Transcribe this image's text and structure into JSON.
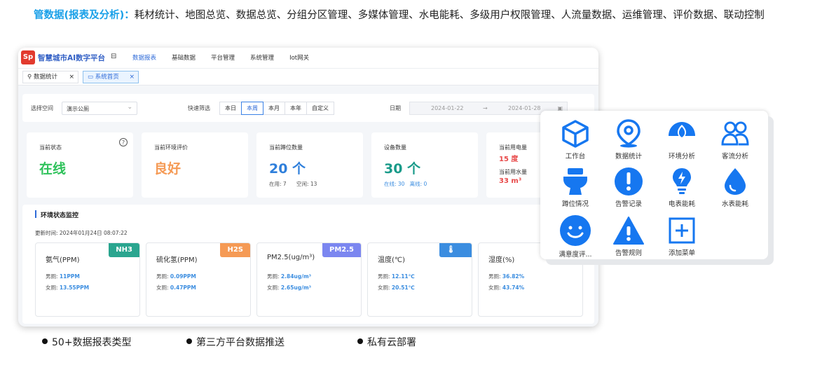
{
  "intro": {
    "heading": "管数据(报表及分析)：",
    "features": "耗材统计、地图总览、数据总览、分组分区管理、多媒体管理、水电能耗、多级用户权限管理、人流量数据、运维管理、评价数据、联动控制"
  },
  "app": {
    "logo_text": "Sp",
    "title": "智慧城市AI数字平台",
    "nav": [
      "数据报表",
      "基础数据",
      "平台管理",
      "系统管理",
      "Iot网关"
    ],
    "active_nav": "数据报表"
  },
  "tabs": [
    {
      "label": "数据统计",
      "close": "×"
    },
    {
      "label": "系统首页",
      "close": "×"
    }
  ],
  "filters": {
    "space_label": "选择空间",
    "space_value": "演示公厕",
    "quick_label": "快速筛选",
    "quick_options": [
      "本日",
      "本周",
      "本月",
      "本年",
      "自定义"
    ],
    "quick_selected": "本周",
    "date_label": "日期",
    "date_start": "2024-01-22",
    "date_sep": "→",
    "date_end": "2024-01-28"
  },
  "cards": {
    "status": {
      "title": "当前状态",
      "value": "在线",
      "color": "#2fc25b"
    },
    "env_eval": {
      "title": "当前环境评价",
      "value": "良好",
      "color": "#f59a55"
    },
    "pits": {
      "title": "当前蹲位数量",
      "value": "20 个",
      "sub": "在用: 7      空闲: 13",
      "color": "#2f7fdb"
    },
    "devices": {
      "title": "设备数量",
      "value": "30 个",
      "sub_online": "在线: 30",
      "sub_offline": "离线: 0",
      "color": "#1a9b8a"
    },
    "power": {
      "title": "当前用电量",
      "value": "15 度",
      "water_title": "当前用水量",
      "water_value": "33 m³",
      "color": "#e84a4a"
    }
  },
  "env": {
    "title": "环境状态监控",
    "updated": "更新时间: 2024年01月24日 08:07:22",
    "sensors": [
      {
        "name": "氨气(PPM)",
        "tag": "NH3",
        "tag_color": "#2aa58f",
        "male_label": "男厕:",
        "male": "11PPM",
        "female_label": "女厕:",
        "female": "13.55PPM"
      },
      {
        "name": "硫化氢(PPM)",
        "tag": "H2S",
        "tag_color": "#f59a55",
        "male_label": "男厕:",
        "male": "0.09PPM",
        "female_label": "女厕:",
        "female": "0.47PPM"
      },
      {
        "name": "PM2.5(ug/m³)",
        "tag": "PM2.5",
        "tag_color": "#7b86f0",
        "male_label": "男厕:",
        "male": "2.84ug/m³",
        "female_label": "女厕:",
        "female": "2.65ug/m³"
      },
      {
        "name": "温度(℃)",
        "tag": "🌡",
        "tag_color": "#3b8de0",
        "male_label": "男厕:",
        "male": "12.11℃",
        "female_label": "女厕:",
        "female": "20.51℃"
      },
      {
        "name": "湿度(%)",
        "tag": "",
        "tag_color": "#ffffff",
        "male_label": "男厕:",
        "male": "36.82%",
        "female_label": "女厕:",
        "female": "43.74%"
      }
    ]
  },
  "popup": {
    "accent": "#1677f0",
    "items": [
      {
        "label": "工作台",
        "icon": "cube-icon"
      },
      {
        "label": "数据统计",
        "icon": "map-pin-icon"
      },
      {
        "label": "环境分析",
        "icon": "lotus-icon"
      },
      {
        "label": "客流分析",
        "icon": "users-icon"
      },
      {
        "label": "蹲位情况",
        "icon": "toilet-icon"
      },
      {
        "label": "告警记录",
        "icon": "alert-circle-icon"
      },
      {
        "label": "电表能耗",
        "icon": "bulb-icon"
      },
      {
        "label": "水表能耗",
        "icon": "water-drop-icon"
      },
      {
        "label": "满意度评...",
        "icon": "smile-icon"
      },
      {
        "label": "告警规则",
        "icon": "warning-triangle-icon"
      },
      {
        "label": "添加菜单",
        "icon": "add-square-icon"
      }
    ]
  },
  "bullets": [
    "50+数据报表类型",
    "第三方平台数据推送",
    "私有云部署"
  ]
}
